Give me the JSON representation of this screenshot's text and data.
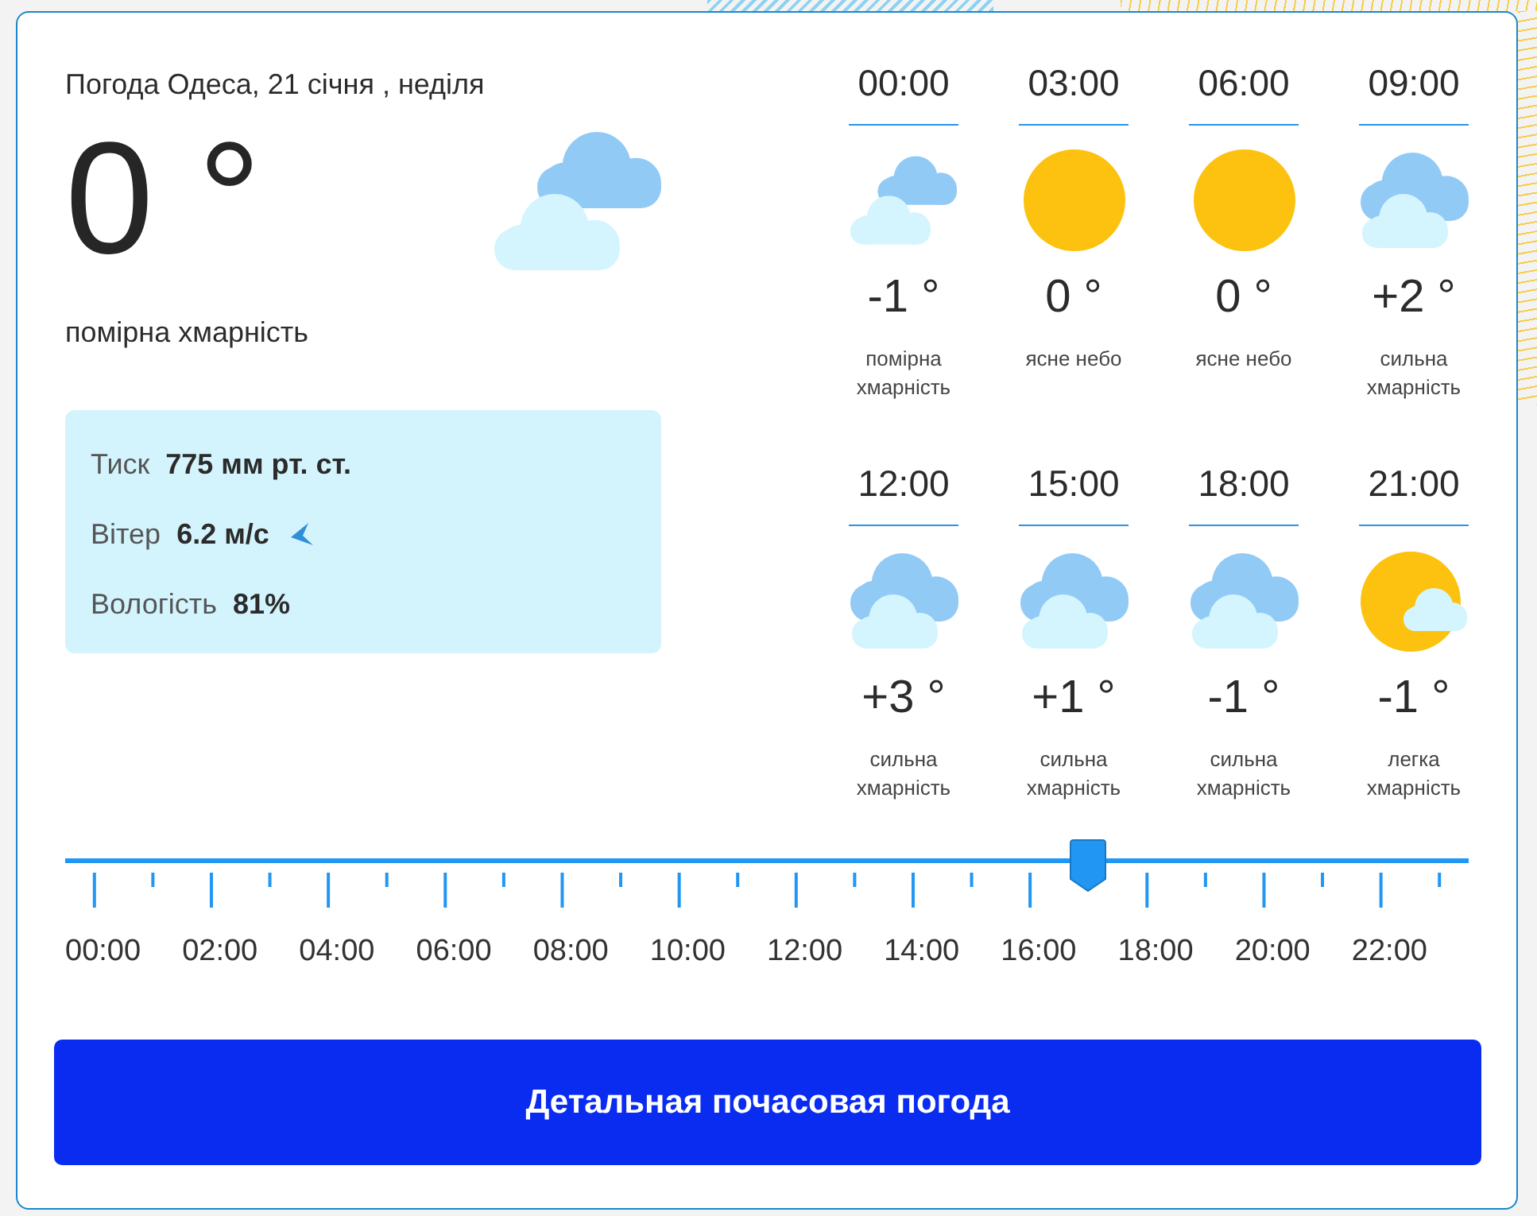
{
  "header": {
    "title": "Погода Одеса, 21 січня , неділя"
  },
  "current": {
    "temperature": "0 °",
    "kind": "clouds",
    "condition": "помірна хмарність"
  },
  "details": [
    {
      "kind": "text",
      "label": "Тиск",
      "value": "775 мм рт. ст."
    },
    {
      "kind": "wind",
      "label": "Вітер",
      "value": "6.2 м/с"
    },
    {
      "kind": "text",
      "label": "Вологість",
      "value": "81%"
    }
  ],
  "forecast": [
    {
      "time": "00:00",
      "kind": "clouds",
      "temperature": "-1 °",
      "condition": "помірна хмарність"
    },
    {
      "time": "03:00",
      "kind": "sun",
      "temperature": "0 °",
      "condition": "ясне небо"
    },
    {
      "time": "06:00",
      "kind": "sun",
      "temperature": "0 °",
      "condition": "ясне небо"
    },
    {
      "time": "09:00",
      "kind": "overcast",
      "temperature": "+2 °",
      "condition": "сильна хмарність"
    },
    {
      "time": "12:00",
      "kind": "overcast",
      "temperature": "+3 °",
      "condition": "сильна хмарність"
    },
    {
      "time": "15:00",
      "kind": "overcast",
      "temperature": "+1 °",
      "condition": "сильна хмарність"
    },
    {
      "time": "18:00",
      "kind": "overcast",
      "temperature": "-1 °",
      "condition": "сильна хмарність"
    },
    {
      "time": "21:00",
      "kind": "suncloud",
      "temperature": "-1 °",
      "condition": "легка хмарність"
    }
  ],
  "timeline": {
    "level": 0.729,
    "labels": [
      "00:00",
      "02:00",
      "04:00",
      "06:00",
      "08:00",
      "10:00",
      "12:00",
      "14:00",
      "16:00",
      "18:00",
      "20:00",
      "22:00"
    ]
  },
  "button": {
    "label": "Детальная почасовая погода"
  }
}
